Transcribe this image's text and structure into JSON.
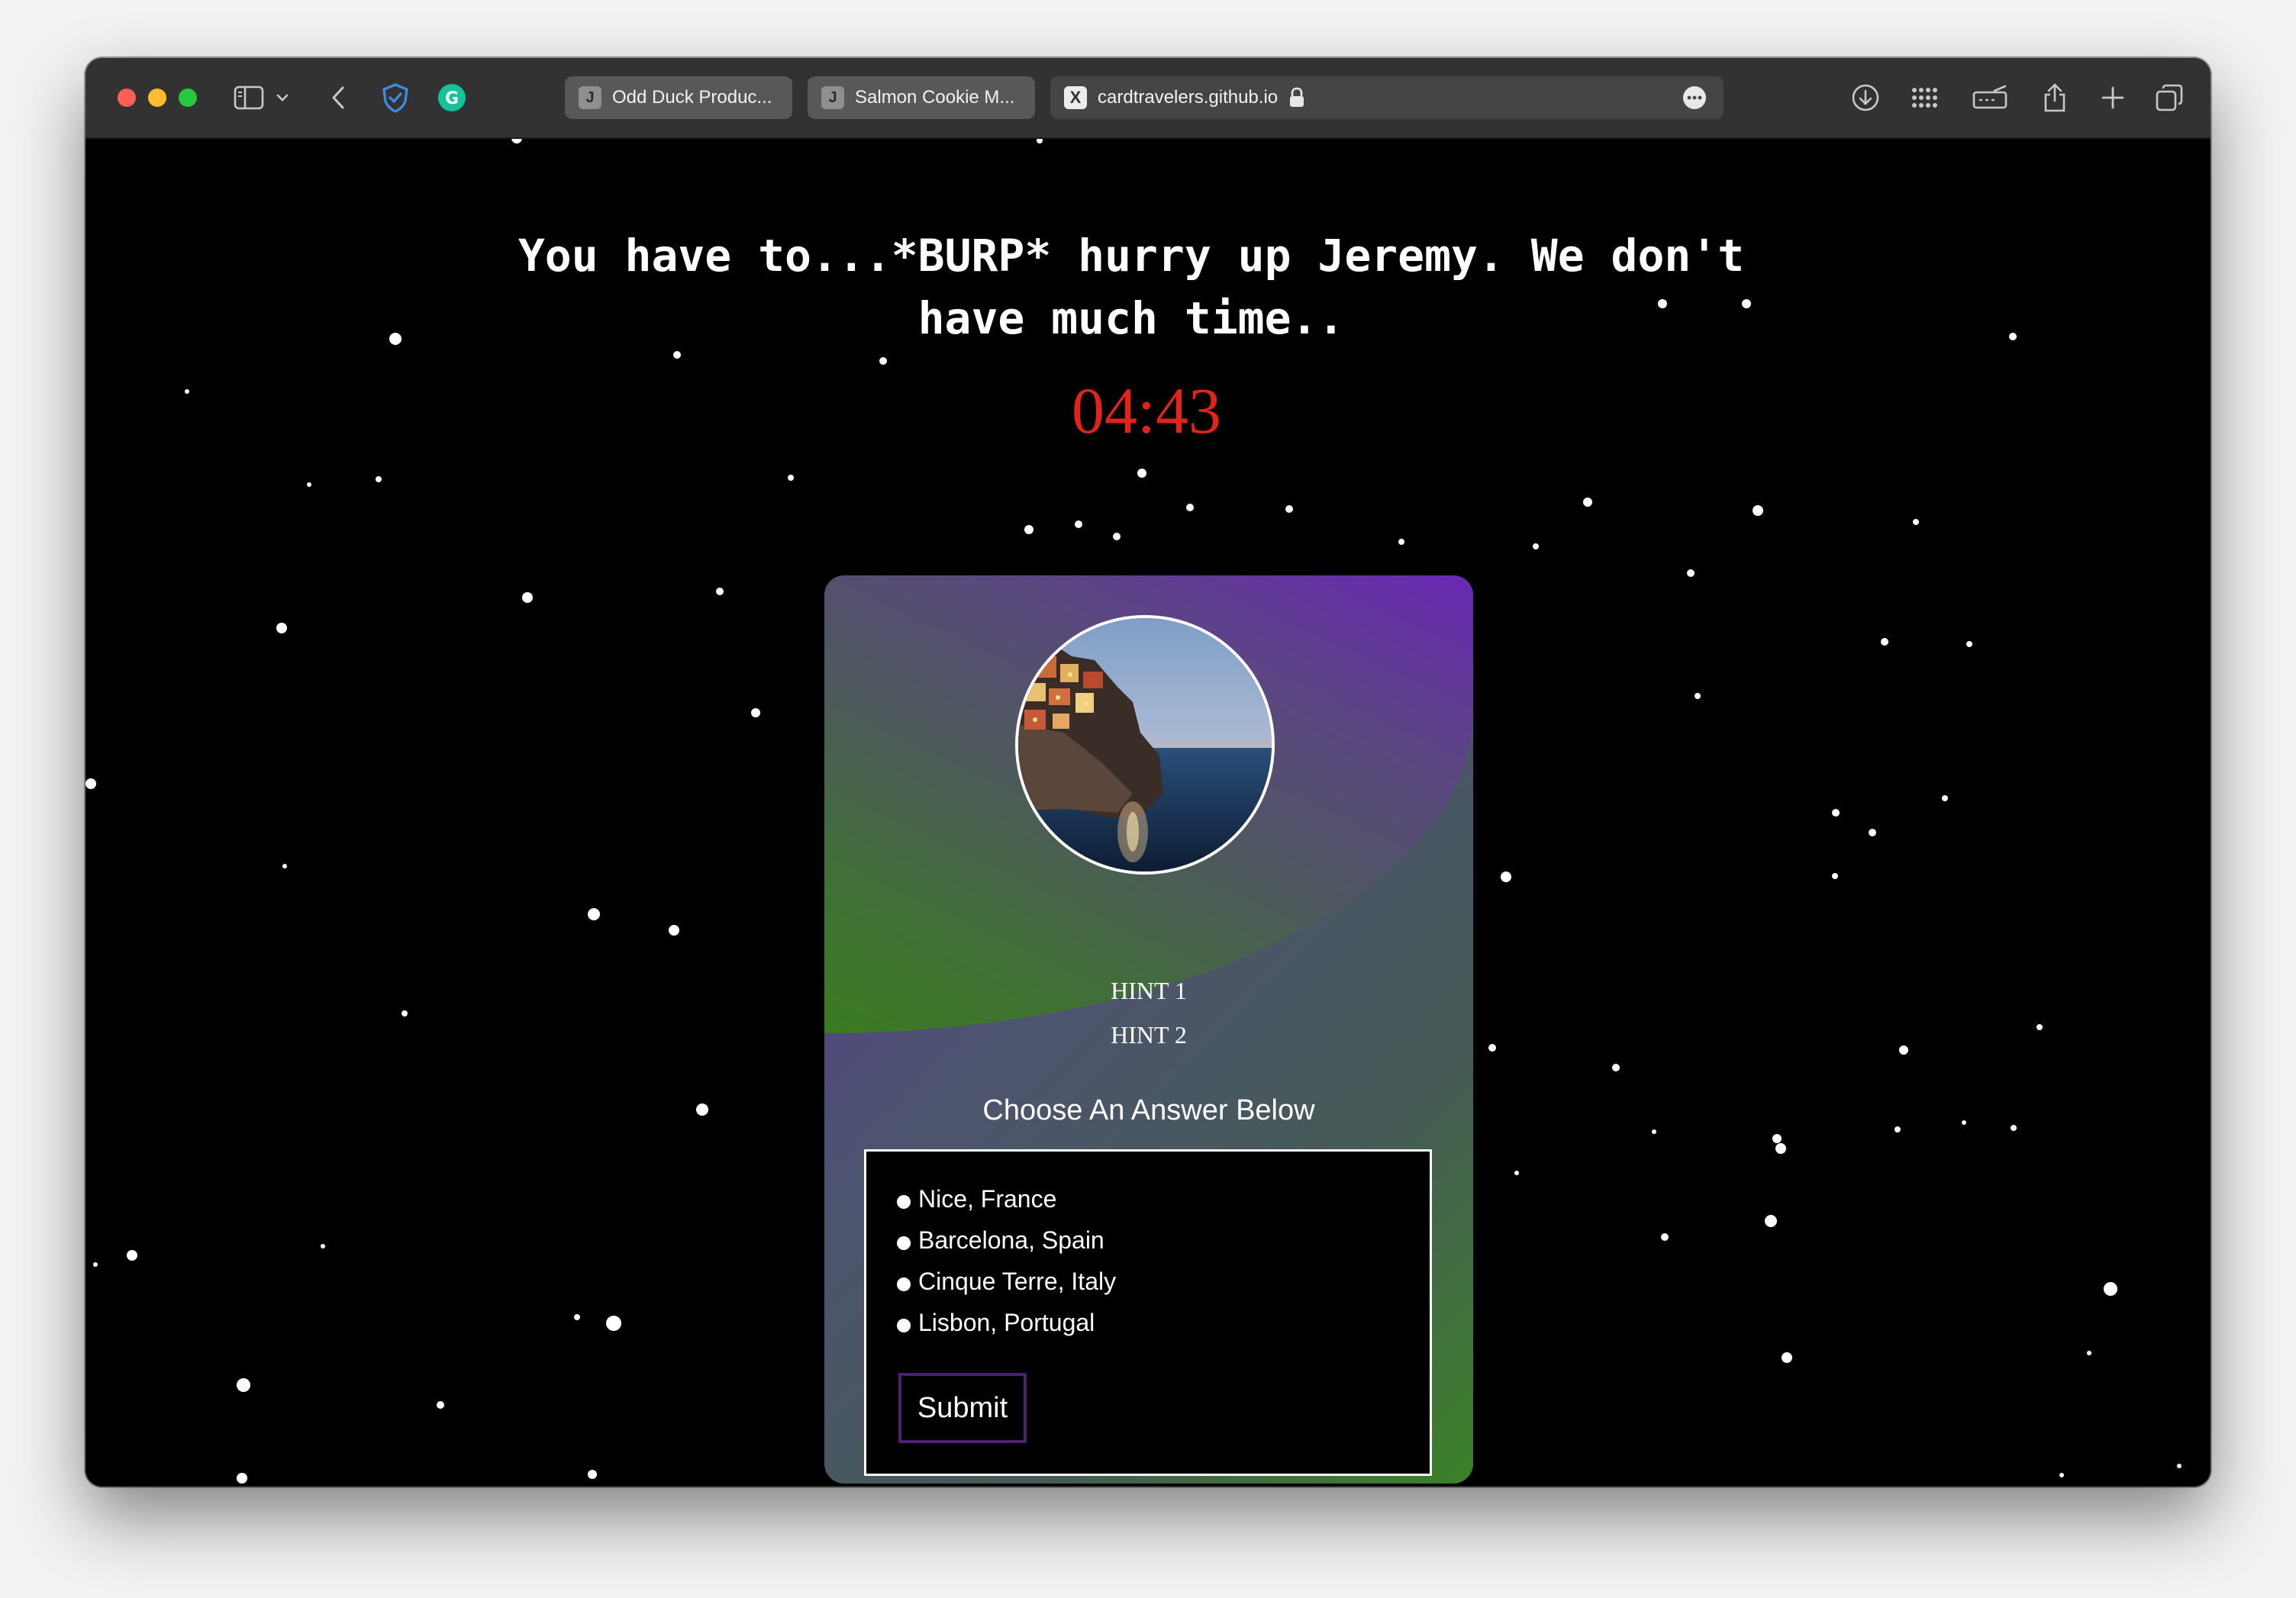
{
  "browser": {
    "tabs": [
      {
        "favicon": "J",
        "title": "Odd Duck Produc..."
      },
      {
        "favicon": "J",
        "title": "Salmon Cookie M..."
      }
    ],
    "active_tab": {
      "favicon": "X",
      "url": "cardtravelers.github.io"
    },
    "icons": [
      "sidebar-icon",
      "chevron-down-icon",
      "back-icon",
      "shield-check-icon",
      "grammarly-icon",
      "lock-icon",
      "more-icon",
      "download-icon",
      "grid-icon",
      "reader-icon",
      "share-icon",
      "plus-icon",
      "tabs-overview-icon"
    ]
  },
  "page": {
    "headline": "You have to...*BURP* hurry up Jeremy. We don't have much time..",
    "timer": "04:43",
    "card": {
      "hint1": "HINT 1",
      "hint2": "HINT 2",
      "prompt": "Choose An Answer Below",
      "options": [
        "Nice, France",
        "Barcelona, Spain",
        "Cinque Terre, Italy",
        "Lisbon, Portugal"
      ],
      "submit_label": "Submit"
    }
  },
  "colors": {
    "background": "#000000",
    "timer": "#e2231a",
    "card_purple": "#5a2d98",
    "card_green": "#3c8228",
    "submit_border": "#4d2070"
  }
}
